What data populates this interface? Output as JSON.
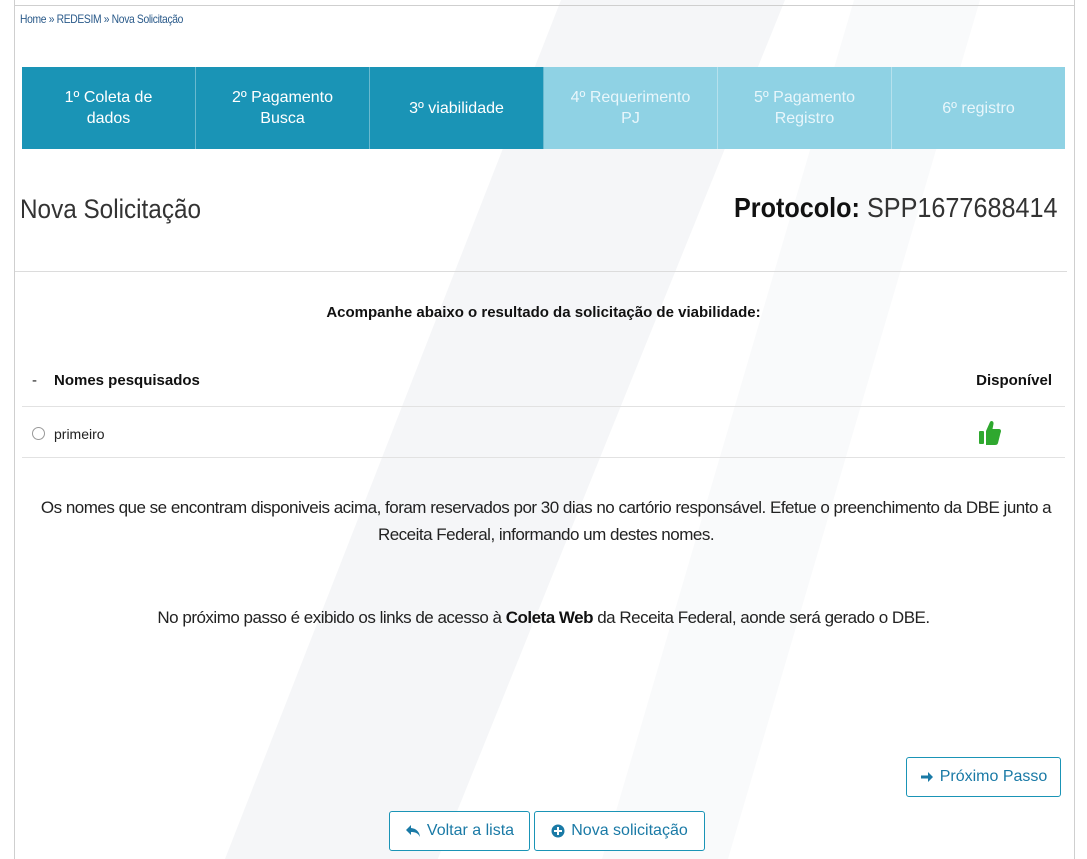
{
  "breadcrumb": {
    "home": "Home",
    "sep1": "»",
    "section": "REDESIM",
    "sep2": "»",
    "current": "Nova Solicitação"
  },
  "steps": [
    {
      "label": "1º Coleta de\ndados",
      "state": "done"
    },
    {
      "label": "2º Pagamento\nBusca",
      "state": "done"
    },
    {
      "label": "3º viabilidade",
      "state": "done"
    },
    {
      "label": "4º Requerimento\nPJ",
      "state": "todo"
    },
    {
      "label": "5º Pagamento\nRegistro",
      "state": "todo"
    },
    {
      "label": "6º registro",
      "state": "todo"
    }
  ],
  "header": {
    "title": "Nova Solicitação",
    "protocol_label": "Protocolo:",
    "protocol_value": " SPP1677688414"
  },
  "result_heading": "Acompanhe abaixo o resultado da solicitação de viabilidade:",
  "table": {
    "col_dash": "-",
    "col_names": "Nomes pesquisados",
    "col_available": "Disponível",
    "rows": [
      {
        "name": "primeiro",
        "available_icon": "thumbs-up-icon"
      }
    ]
  },
  "info": {
    "paragraph1": "Os nomes que se encontram disponiveis acima, foram reservados por 30 dias no cartório responsável. Efetue o preenchimento da DBE junto a Receita Federal, informando um destes nomes.",
    "p2_before": "No próximo passo é exibido os links de acesso à ",
    "p2_bold": "Coleta Web",
    "p2_after": " da Receita Federal, aonde será gerado o DBE."
  },
  "buttons": {
    "next": "Próximo Passo",
    "back": "Voltar a lista",
    "new": "Nova solicitação"
  },
  "colors": {
    "accent": "#1a94b6",
    "step_done": "#1a94b6",
    "step_todo": "#8fd2e4",
    "thumb": "#2fa82f"
  }
}
